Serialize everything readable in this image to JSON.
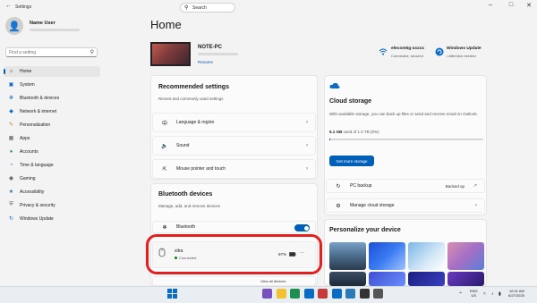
{
  "window": {
    "title": "Settings",
    "back_icon": "back-arrow-icon"
  },
  "sidebar": {
    "user_name": "Name User",
    "search_placeholder": "Find a setting",
    "items": [
      {
        "label": "Home",
        "icon": "home-icon",
        "active": true
      },
      {
        "label": "System",
        "icon": "system-icon"
      },
      {
        "label": "Bluetooth & devices",
        "icon": "bluetooth-icon"
      },
      {
        "label": "Network & internet",
        "icon": "network-icon"
      },
      {
        "label": "Personalization",
        "icon": "brush-icon"
      },
      {
        "label": "Apps",
        "icon": "apps-icon"
      },
      {
        "label": "Accounts",
        "icon": "accounts-icon"
      },
      {
        "label": "Time & language",
        "icon": "globe-icon"
      },
      {
        "label": "Gaming",
        "icon": "gaming-icon"
      },
      {
        "label": "Accessibility",
        "icon": "accessibility-icon"
      },
      {
        "label": "Privacy & security",
        "icon": "shield-icon"
      },
      {
        "label": "Windows Update",
        "icon": "update-icon"
      }
    ]
  },
  "main": {
    "title": "Home",
    "device": {
      "name": "NOTE-PC",
      "rename": "Rename"
    },
    "network": {
      "name": "elecom5g-xxxxx",
      "status": "Connected, secured"
    },
    "update": {
      "name": "Windows Update",
      "status": "• Attention needed"
    }
  },
  "recommended": {
    "title": "Recommended settings",
    "subtitle": "Recent and commonly used settings",
    "items": [
      {
        "label": "Language & region",
        "icon": "language-icon"
      },
      {
        "label": "Sound",
        "icon": "speaker-icon"
      },
      {
        "label": "Mouse pointer and touch",
        "icon": "mouse-pointer-icon"
      }
    ]
  },
  "bluetooth": {
    "title": "Bluetooth devices",
    "subtitle": "Manage, add, and remove devices",
    "toggle_label": "Bluetooth",
    "toggle_on": true,
    "device": {
      "name": "sitra",
      "status": "Connected",
      "battery": "97%",
      "more": "···"
    },
    "partial_label": "View all devices"
  },
  "cloud": {
    "title": "Cloud storage",
    "description": "With available storage, you can back up files or send and receive email on Outlook.",
    "usage_amount": "5.1 GB",
    "usage_rest": "used of 1.0 TB (0%)",
    "usage_fraction": 0.005,
    "button": "Get more storage",
    "pc_backup": "PC backup",
    "pc_backup_status": "Backed up",
    "manage": "Manage cloud storage"
  },
  "personalize": {
    "title": "Personalize your device"
  },
  "taskbar": {
    "search_label": "Search",
    "lang_top": "ENG",
    "lang_bottom": "US",
    "time": "10:01 AM",
    "date": "6/27/2025"
  },
  "colors": {
    "accent": "#005fb8",
    "highlight": "#e4201f"
  }
}
